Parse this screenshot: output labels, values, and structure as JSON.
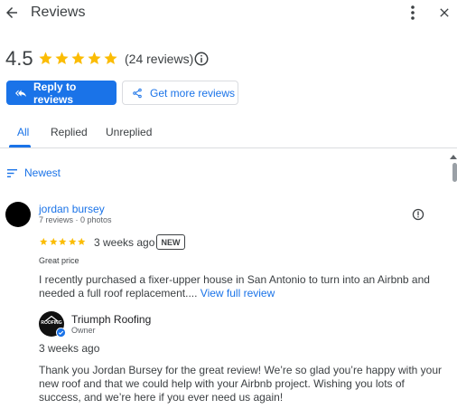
{
  "header": {
    "title": "Reviews",
    "icons": [
      "back-arrow-icon",
      "more-vert-icon",
      "close-icon"
    ]
  },
  "summary": {
    "rating": "4.5",
    "stars": 5,
    "review_count": "(24 reviews)"
  },
  "actions": {
    "reply_label": "Reply to reviews",
    "more_label": "Get more reviews"
  },
  "tabs": [
    {
      "label": "All",
      "selected": true
    },
    {
      "label": "Replied",
      "selected": false
    },
    {
      "label": "Unreplied",
      "selected": false
    }
  ],
  "sort": {
    "label": "Newest"
  },
  "review": {
    "reviewer_name": "jordan bursey",
    "reviewer_meta": "7 reviews · 0 photos",
    "rating": 5,
    "time": "3 weeks ago",
    "badge": "NEW",
    "tag": "Great price",
    "text": "I recently purchased a fixer-upper house in San Antonio to turn into an Airbnb and needed a full roof replacement....",
    "view_full": "View full review"
  },
  "owner_reply": {
    "logo_text": "ROOFING",
    "name": "Triumph Roofing",
    "role": "Owner",
    "time": "3 weeks ago",
    "text": "Thank you Jordan Bursey for the great review! We’re so glad you’re happy with your new roof and that we could help with your Airbnb project. Wishing you lots of success, and we’re here if you ever need us again!"
  },
  "colors": {
    "accent": "#1a73e8",
    "star": "#fbbc04",
    "text": "#3c4043",
    "secondary": "#5f6368",
    "divider": "#dadce0"
  }
}
